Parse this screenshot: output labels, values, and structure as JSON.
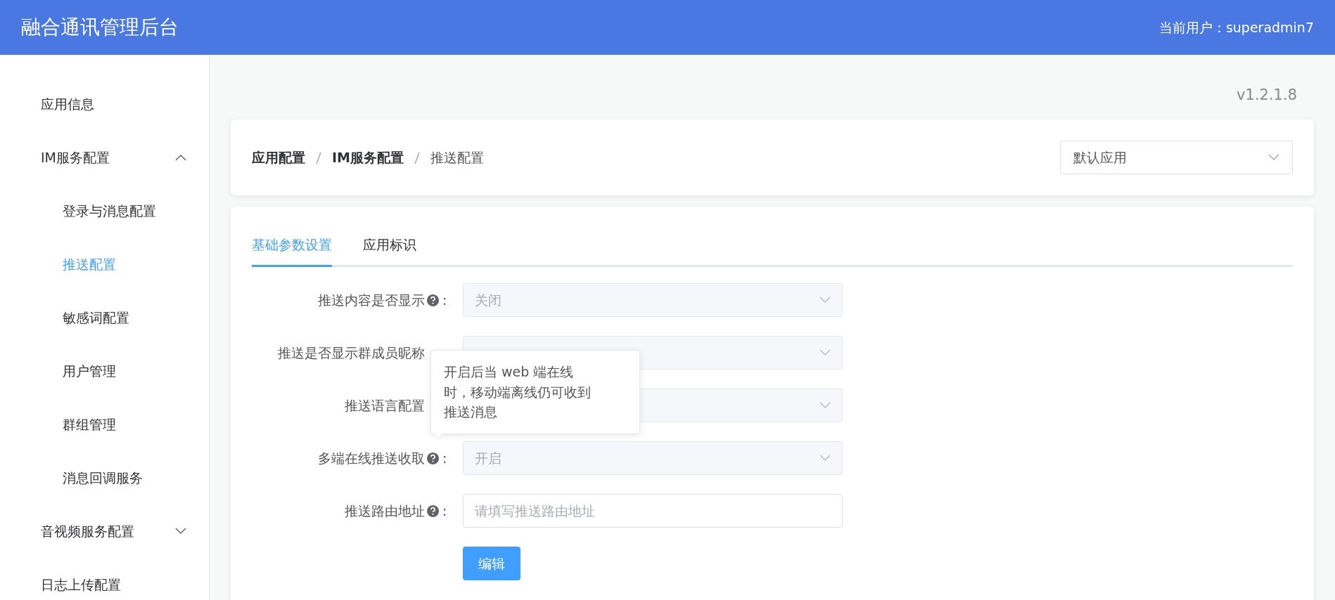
{
  "header": {
    "title": "融合通讯管理后台",
    "user": "当前用户：superadmin7"
  },
  "sidebar": {
    "items": [
      {
        "label": "应用信息",
        "selected": false
      },
      {
        "label": "IM服务配置",
        "selected": false,
        "expanded": true,
        "children": [
          {
            "label": "登录与消息配置",
            "selected": false
          },
          {
            "label": "推送配置",
            "selected": true
          },
          {
            "label": "敏感词配置",
            "selected": false
          },
          {
            "label": "用户管理",
            "selected": false
          },
          {
            "label": "群组管理",
            "selected": false
          },
          {
            "label": "消息回调服务",
            "selected": false
          }
        ]
      },
      {
        "label": "音视频服务配置",
        "selected": false,
        "expanded": false
      },
      {
        "label": "日志上传配置",
        "selected": false
      }
    ]
  },
  "version": "v1.2.1.8",
  "breadcrumb": [
    "应用配置",
    "IM服务配置",
    "推送配置"
  ],
  "app_select": {
    "value": "默认应用"
  },
  "tabs": [
    {
      "label": "基础参数设置",
      "selected": true
    },
    {
      "label": "应用标识",
      "selected": false
    }
  ],
  "form": {
    "rows": [
      {
        "kind": "select",
        "label": "推送内容是否显示",
        "help": true,
        "suffix": ":",
        "value": "关闭",
        "disabled": true
      },
      {
        "kind": "select",
        "label": "推送是否显示群成员昵称",
        "help": false,
        "disabled": true
      },
      {
        "kind": "select",
        "label": "推送语言配置",
        "help": false,
        "disabled": true
      },
      {
        "kind": "select",
        "label": "多端在线推送收取",
        "help": true,
        "suffix": ":",
        "value": "开启",
        "disabled": true
      },
      {
        "kind": "input",
        "label": "推送路由地址",
        "help": true,
        "suffix": ":",
        "placeholder": "请填写推送路由地址",
        "disabled": false
      }
    ],
    "button": "编辑"
  },
  "tooltip": {
    "text": "开启后当  web 端在线时，移动端离线仍可收到推送消息"
  }
}
